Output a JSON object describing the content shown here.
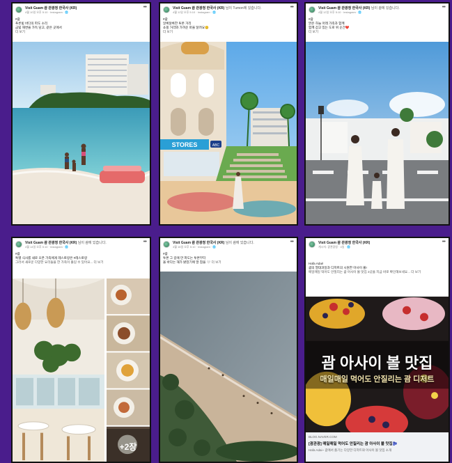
{
  "posts": [
    {
      "page": "Visit Guam 괌 관광청 한국사 (KR)",
      "page_extra": "",
      "meta": "4월 10일 오후 5:10 · Instagram · 🌐",
      "text": [
        "#괌",
        "푸른빛 바다의 파도 소리",
        "금빛 해변을 가득 담고, 같은 곳에서",
        "더 보기"
      ],
      "photo_icon": "beach-hotel-photo"
    },
    {
      "page": "Visit Guam 괌 관광청 한국사 (KR)",
      "page_extra": "님이 Tumon에 있습니다.",
      "meta": "4월 11일 오후 5:10 · Instagram · 🌐",
      "text": [
        "#괌",
        "알록달록한 투몬 거리",
        "쇼핑 거리와 가까운 마을 달려요😊",
        "더 보기"
      ],
      "photo_icon": "street-stores-photo",
      "sign": "STORES",
      "sign2": "ABC"
    },
    {
      "page": "Visit Guam 괌 관광청 한국사 (KR)",
      "page_extra": "님이 괌에 있습니다.",
      "meta": "4월 12일 오후 5:10 · Instagram · 🌐",
      "text": [
        "#괌",
        "맑은 하늘 아래 가족과 함께",
        "함께 걷고 있는 도로 위 순간❤️",
        "더 보기"
      ],
      "photo_icon": "family-walking-photo"
    },
    {
      "page": "Visit Guam 괌 관광청 한국사 (KR)",
      "page_extra": "님이 괌에 있습니다.",
      "meta": "4월 14일 오후 5:10 · Instagram · 🌐",
      "text": [
        "#괌",
        "특별 식사를 새로 오픈 가족에게 레스토랑은 #레스토랑",
        "그러서 새로운 다양한 요리들을 한 가족이 즐길 수 있어요... 더 보기"
      ],
      "photo_icon": "restaurant-photo",
      "plus_count": "+2장"
    },
    {
      "page": "Visit Guam 괌 관광청 한국사 (KR)",
      "page_extra": "님이 괌에 있습니다.",
      "meta": "4월 16일 오후 5:10 · Instagram · 🌐",
      "text": [
        "#괌",
        "투몬 그 길에 만 파도는 투몬부터",
        "올 바다는 해가 밝았기에 말 참을 🤍",
        "더 보기"
      ],
      "photo_icon": "aerial-beach-photo"
    },
    {
      "page": "Visit Guam 괌 관광청 한국사 (KR)",
      "page_extra": "",
      "meta": "게시자: 광관광청 · 4일 · 🌐",
      "text": [
        "Hafa Adai!",
        "괌의 열대과일과 디저트의 시원한 아사이 볼!",
        "매일매일 먹어도 안질리는 괌 아사이 볼 맛집 3곳을 지금 바로 확인해보세요... 더 보기"
      ],
      "photo_icon": "acai-bowl-photo",
      "overlay_title": "괌 아사이 볼 맛집",
      "overlay_sub": "매일매일 먹어도 안질리는 괌 디저트",
      "link_domain": "BLOG.NAVER.COM",
      "link_title": "[괌관광] 매일매일 먹어도 안질리는 괌 아사이 볼 맛집🫐",
      "link_desc": "Hafa Adai~ 괌에서 즐기는 다양한 디저트와 아사이 볼 맛집 소개"
    }
  ],
  "colors": {
    "background": "#4a1d8c",
    "card": "#ffffff",
    "border": "#111111"
  }
}
